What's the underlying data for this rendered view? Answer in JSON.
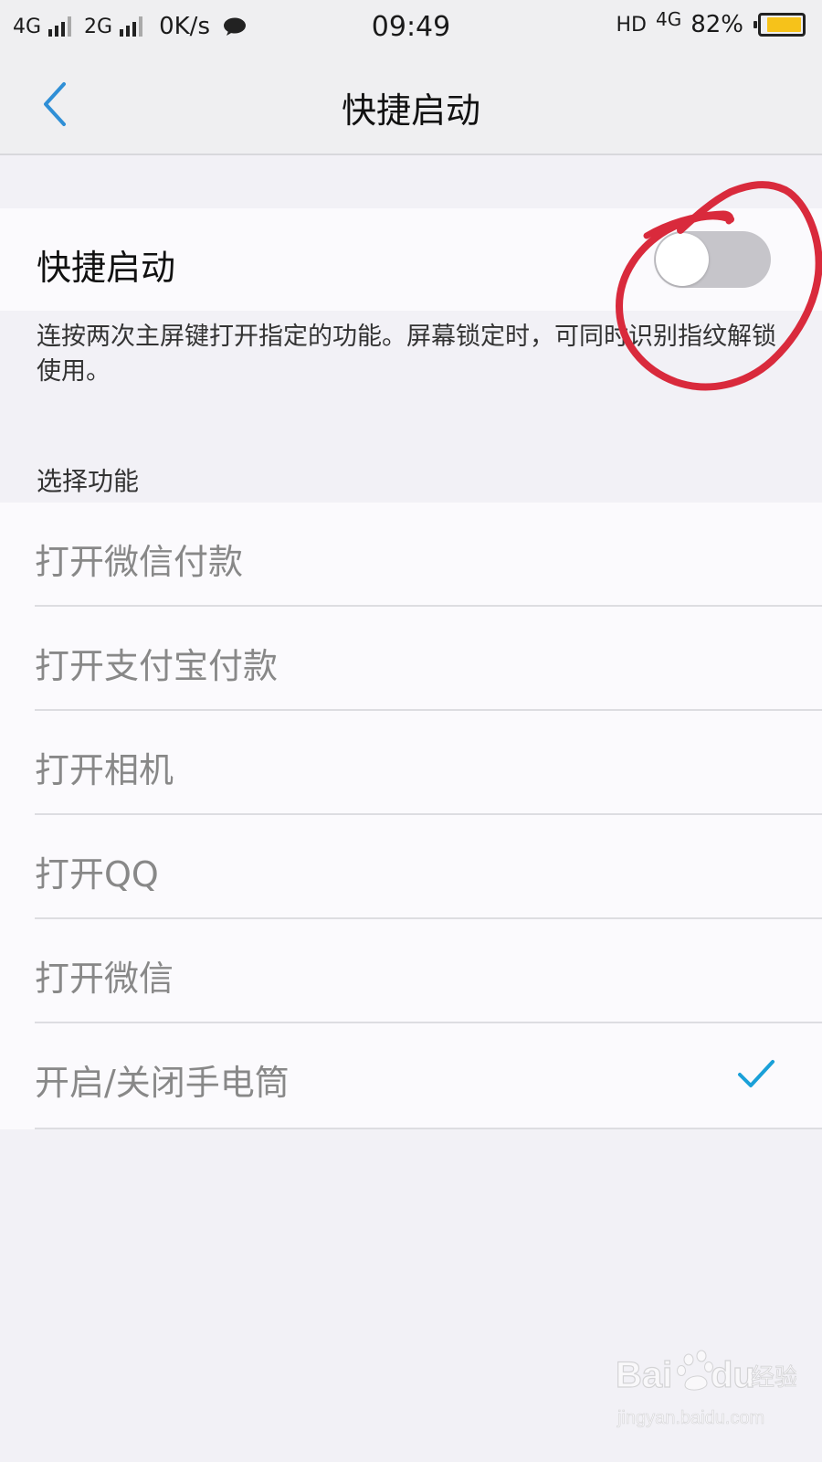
{
  "status_bar": {
    "net1": "4G",
    "net2": "2G",
    "speed": "0K/s",
    "time": "09:49",
    "hd": "HD",
    "net3": "4G",
    "battery": "82%"
  },
  "nav": {
    "title": "快捷启动"
  },
  "toggle": {
    "label": "快捷启动",
    "state": "off"
  },
  "description": "连按两次主屏键打开指定的功能。屏幕锁定时，可同时识别指纹解锁使用。",
  "section_header": "选择功能",
  "options": [
    {
      "label": "打开微信付款",
      "selected": false
    },
    {
      "label": "打开支付宝付款",
      "selected": false
    },
    {
      "label": "打开相机",
      "selected": false
    },
    {
      "label": "打开QQ",
      "selected": false
    },
    {
      "label": "打开微信",
      "selected": false
    },
    {
      "label": "开启/关闭手电筒",
      "selected": true
    }
  ],
  "watermark": {
    "brand": "Bai du 经验",
    "url": "jingyan.baidu.com"
  },
  "colors": {
    "accent": "#2f8fd6",
    "check": "#1aa0d8",
    "annotation": "#d92a3c",
    "battery": "#f6c21a"
  }
}
